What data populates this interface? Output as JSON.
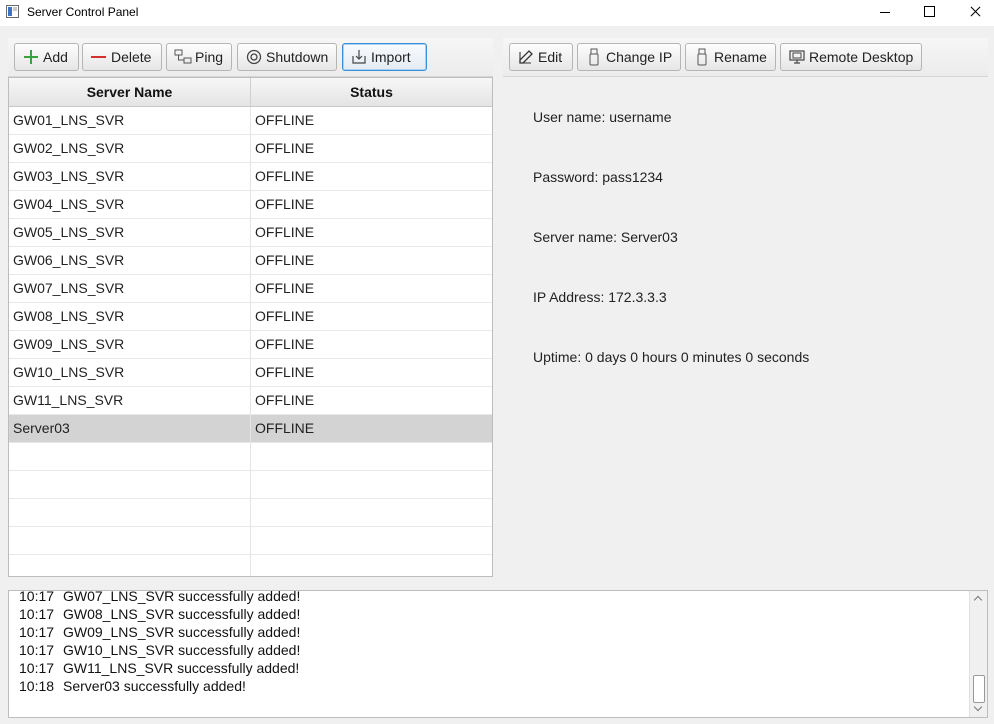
{
  "window": {
    "title": "Server Control Panel"
  },
  "toolbar_left": {
    "add": "Add",
    "delete": "Delete",
    "ping": "Ping",
    "shutdown": "Shutdown",
    "import": "Import"
  },
  "toolbar_right": {
    "edit": "Edit",
    "change_ip": "Change IP",
    "rename": "Rename",
    "remote_desktop": "Remote Desktop"
  },
  "table": {
    "headers": {
      "name": "Server Name",
      "status": "Status"
    },
    "rows": [
      {
        "name": "GW01_LNS_SVR",
        "status": "OFFLINE"
      },
      {
        "name": "GW02_LNS_SVR",
        "status": "OFFLINE"
      },
      {
        "name": "GW03_LNS_SVR",
        "status": "OFFLINE"
      },
      {
        "name": "GW04_LNS_SVR",
        "status": "OFFLINE"
      },
      {
        "name": "GW05_LNS_SVR",
        "status": "OFFLINE"
      },
      {
        "name": "GW06_LNS_SVR",
        "status": "OFFLINE"
      },
      {
        "name": "GW07_LNS_SVR",
        "status": "OFFLINE"
      },
      {
        "name": "GW08_LNS_SVR",
        "status": "OFFLINE"
      },
      {
        "name": "GW09_LNS_SVR",
        "status": "OFFLINE"
      },
      {
        "name": "GW10_LNS_SVR",
        "status": "OFFLINE"
      },
      {
        "name": "GW11_LNS_SVR",
        "status": "OFFLINE"
      },
      {
        "name": "Server03",
        "status": "OFFLINE"
      }
    ],
    "selected_row": 11
  },
  "details": {
    "username": "User name: username",
    "password": "Password: pass1234",
    "server_name": "Server name: Server03",
    "ip": "IP Address: 172.3.3.3",
    "uptime": "Uptime: 0 days 0 hours 0 minutes 0 seconds"
  },
  "log": [
    {
      "time": "10:17",
      "msg": "GW07_LNS_SVR successfully added!"
    },
    {
      "time": "10:17",
      "msg": "GW08_LNS_SVR successfully added!"
    },
    {
      "time": "10:17",
      "msg": "GW09_LNS_SVR successfully added!"
    },
    {
      "time": "10:17",
      "msg": "GW10_LNS_SVR successfully added!"
    },
    {
      "time": "10:17",
      "msg": "GW11_LNS_SVR successfully added!"
    },
    {
      "time": "10:18",
      "msg": "Server03 successfully added!"
    }
  ]
}
